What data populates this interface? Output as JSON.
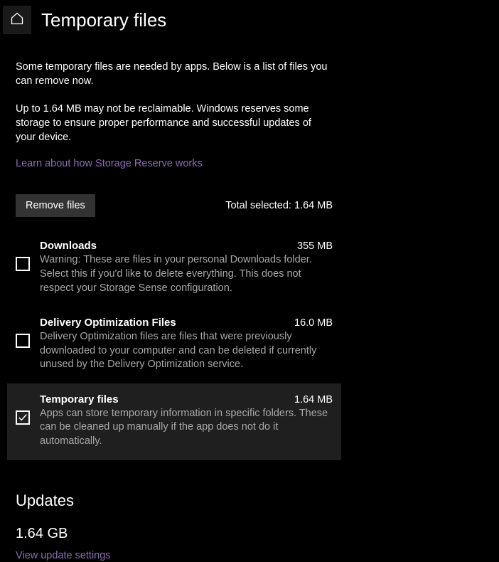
{
  "header": {
    "title": "Temporary files"
  },
  "intro": {
    "p1": "Some temporary files are needed by apps. Below is a list of files you can remove now.",
    "p2": "Up to 1.64 MB may not be reclaimable. Windows reserves some storage to ensure proper performance and successful updates of your device.",
    "learn_link": "Learn about how Storage Reserve works"
  },
  "actions": {
    "remove_label": "Remove files",
    "total_selected": "Total selected: 1.64 MB"
  },
  "files": {
    "items": [
      {
        "title": "Downloads",
        "size": "355 MB",
        "desc": "Warning: These are files in your personal Downloads folder. Select this if you'd like to delete everything. This does not respect your Storage Sense configuration.",
        "checked": false
      },
      {
        "title": "Delivery Optimization Files",
        "size": "16.0 MB",
        "desc": "Delivery Optimization files are files that were previously downloaded to your computer and can be deleted if currently unused by the Delivery Optimization service.",
        "checked": false
      },
      {
        "title": "Temporary files",
        "size": "1.64 MB",
        "desc": "Apps can store temporary information in specific folders. These can be cleaned up manually if the app does not do it automatically.",
        "checked": true
      }
    ]
  },
  "updates": {
    "heading": "Updates",
    "size": "1.64 GB",
    "link": "View update settings"
  }
}
